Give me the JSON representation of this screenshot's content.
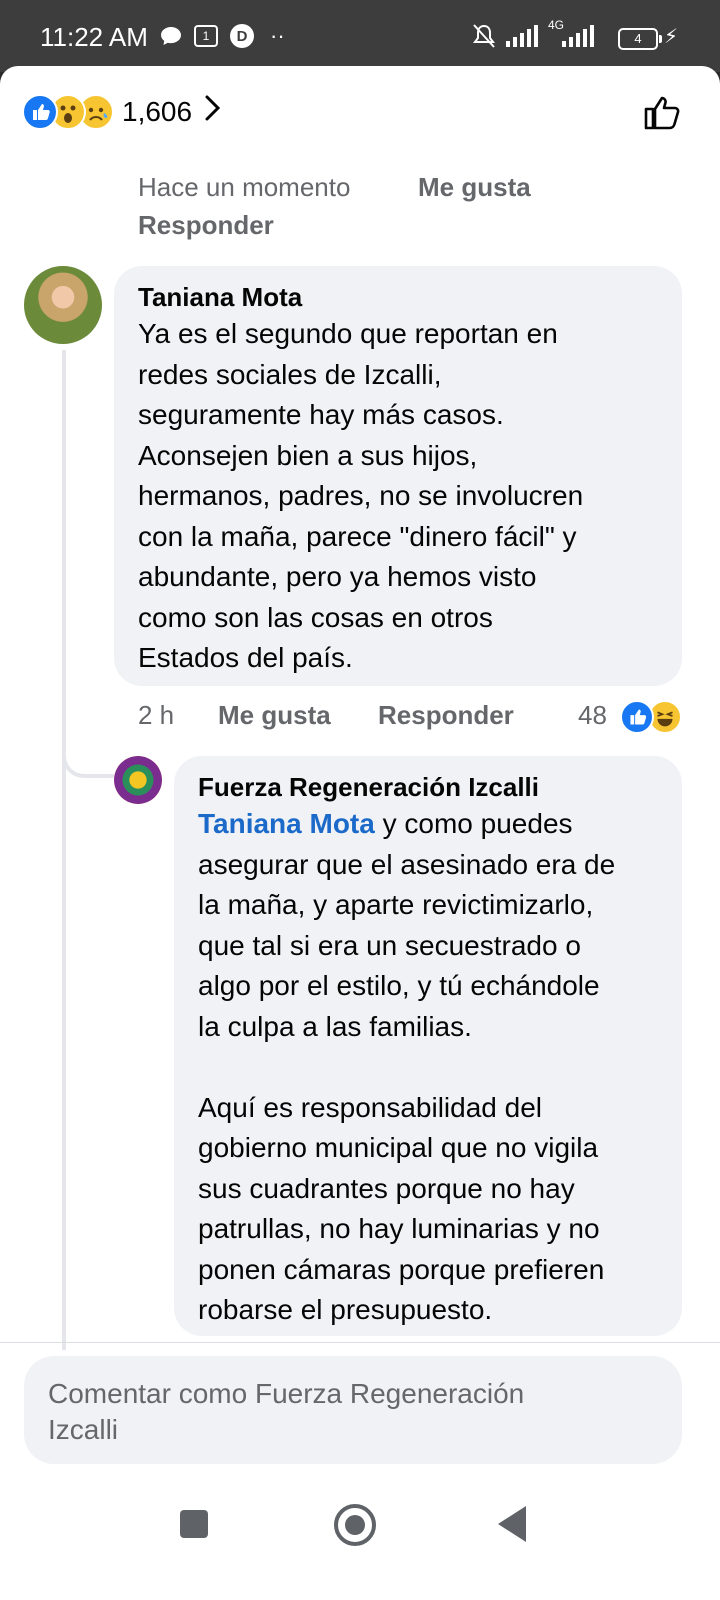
{
  "status_bar": {
    "time": "11:22 AM",
    "battery": "4",
    "network": "4G"
  },
  "reactions_header": {
    "count": "1,606",
    "icons": [
      "like-reaction",
      "wow-reaction",
      "sad-reaction"
    ]
  },
  "previous_comment": {
    "time": "Hace un momento",
    "like": "Me gusta",
    "reply": "Responder"
  },
  "comment": {
    "author": "Taniana Mota",
    "text": "Ya es el segundo que reportan en\nredes sociales de Izcalli,\nseguramente hay más casos.\nAconsejen bien a sus hijos,\nhermanos, padres, no se involucren\ncon la maña, parece \"dinero fácil\" y\nabundante, pero ya hemos visto\ncomo son las cosas en otros\nEstados del país.",
    "time": "2 h",
    "like": "Me gusta",
    "reply": "Responder",
    "reaction_count": "48"
  },
  "reply": {
    "author": "Fuerza Regeneración Izcalli",
    "mention": "Taniana Mota",
    "text_after_mention": " y como puedes\nasegurar que el asesinado era de\nla maña, y aparte revictimizarlo,\nque tal si era un secuestrado o\nalgo por el estilo, y tú echándole\nla culpa a las familias.\n\nAquí es responsabilidad del\ngobierno municipal que no vigila\nsus cuadrantes porque no hay\npatrullas, no hay luminarias y no\nponen cámaras porque prefieren\nrobarse el presupuesto."
  },
  "composer": {
    "placeholder": "Comentar como Fuerza Regeneración\nIzcalli"
  },
  "colors": {
    "link": "#1b6ac9",
    "bubble": "#f0f2f5",
    "meta": "#65676b",
    "like_blue": "#1877f2"
  }
}
